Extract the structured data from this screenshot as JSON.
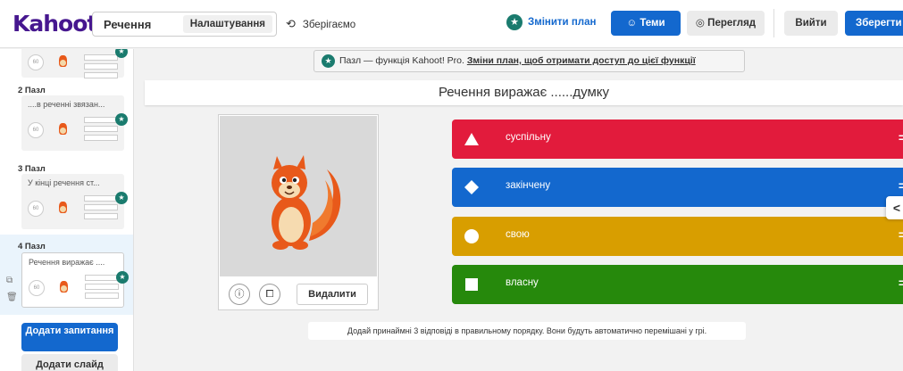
{
  "header": {
    "logo": "Kahoot!",
    "quiz_title": "Речення",
    "settings_label": "Налаштування",
    "saving_label": "Зберігаємо",
    "change_plan_label": "Змінити план",
    "themes_label": "Теми",
    "preview_label": "Перегляд",
    "exit_label": "Вийти",
    "save_label": "Зберегти"
  },
  "sidebar": {
    "slides": [
      {
        "label": "",
        "question": "",
        "timer": "60"
      },
      {
        "label": "2  Пазл",
        "question": "....в реченні звязан...",
        "timer": "60"
      },
      {
        "label": "3  Пазл",
        "question": "У кінці речення ст...",
        "timer": "60"
      },
      {
        "label": "4  Пазл",
        "question": "Речення виражає ....",
        "timer": "60"
      }
    ],
    "add_question_label": "Додати запитання",
    "add_slide_label": "Додати слайд"
  },
  "promo": {
    "text": "Пазл — функція Kahoot! Pro. ",
    "link": "Зміни план, щоб отримати доступ до цієї функції"
  },
  "question": {
    "text": "Речення виражає ......думку"
  },
  "media": {
    "info_icon": "info-icon",
    "crop_icon": "crop-icon",
    "delete_label": "Видалити"
  },
  "answers": [
    {
      "text": "суспільну",
      "shape": "triangle",
      "color": "#e21b3c"
    },
    {
      "text": "закінчену",
      "shape": "diamond",
      "color": "#1368ce"
    },
    {
      "text": "свою",
      "shape": "circle",
      "color": "#d89e00"
    },
    {
      "text": "власну",
      "shape": "square",
      "color": "#26890c"
    }
  ],
  "hint": "Додай принаймні 3 відповіді в правильному порядку. Вони будуть автоматично перемішані у грі.",
  "colors": {
    "brand": "#46178f",
    "primary": "#1368ce",
    "premium": "#1a7b6e"
  }
}
